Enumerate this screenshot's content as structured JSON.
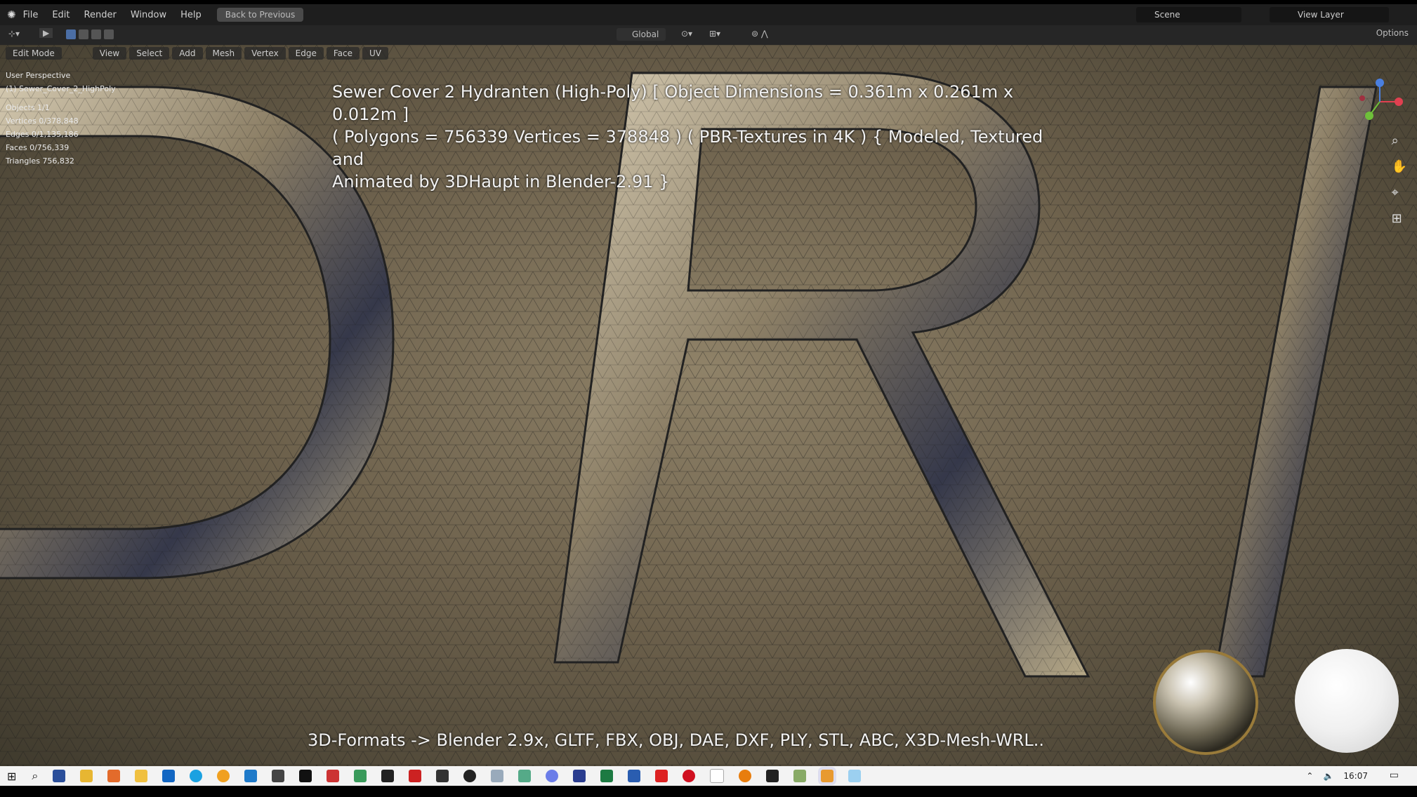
{
  "topbar": {
    "menu": [
      "File",
      "Edit",
      "Render",
      "Window",
      "Help"
    ],
    "back_label": "Back to Previous",
    "scene_label": "Scene",
    "view_layer_label": "View Layer"
  },
  "toolbar": {
    "transform_orientation": "Global",
    "options_label": "Options"
  },
  "viewport_header": {
    "mode": "Edit Mode",
    "menus": [
      "View",
      "Select",
      "Add",
      "Mesh",
      "Vertex",
      "Edge",
      "Face",
      "UV"
    ]
  },
  "stats": {
    "view": "User Perspective",
    "object": "(1) Sewer_Cover_2_HighPoly",
    "objects": "Objects     1/1",
    "vertices": "Vertices    0/378,848",
    "edges": "Edges       0/1,135,186",
    "faces": "Faces       0/756,339",
    "triangles": "Triangles   756,832"
  },
  "overlay": {
    "title_line1": "Sewer Cover 2 Hydranten (High-Poly) [ Object Dimensions = 0.361m x 0.261m x 0.012m ]",
    "title_line2": "( Polygons = 756339 Vertices = 378848 ) ( PBR-Textures in 4K ) { Modeled, Textured and",
    "title_line3": "Animated by 3DHaupt in Blender-2.91 }",
    "formats": "3D-Formats -> Blender 2.9x, GLTF, FBX, OBJ, DAE, DXF, PLY, STL, ABC, X3D-Mesh-WRL.."
  },
  "taskbar": {
    "icons": [
      "windows-start",
      "search",
      "save",
      "explorer",
      "firefox",
      "notes",
      "outlook",
      "skype",
      "chrome",
      "app",
      "app",
      "app",
      "app",
      "app",
      "app",
      "app",
      "app",
      "app",
      "app",
      "app",
      "app",
      "app",
      "app",
      "excel",
      "word",
      "app",
      "opera",
      "file",
      "blender",
      "terminal",
      "app",
      "blender-active",
      "app"
    ],
    "clock": "16:07"
  }
}
